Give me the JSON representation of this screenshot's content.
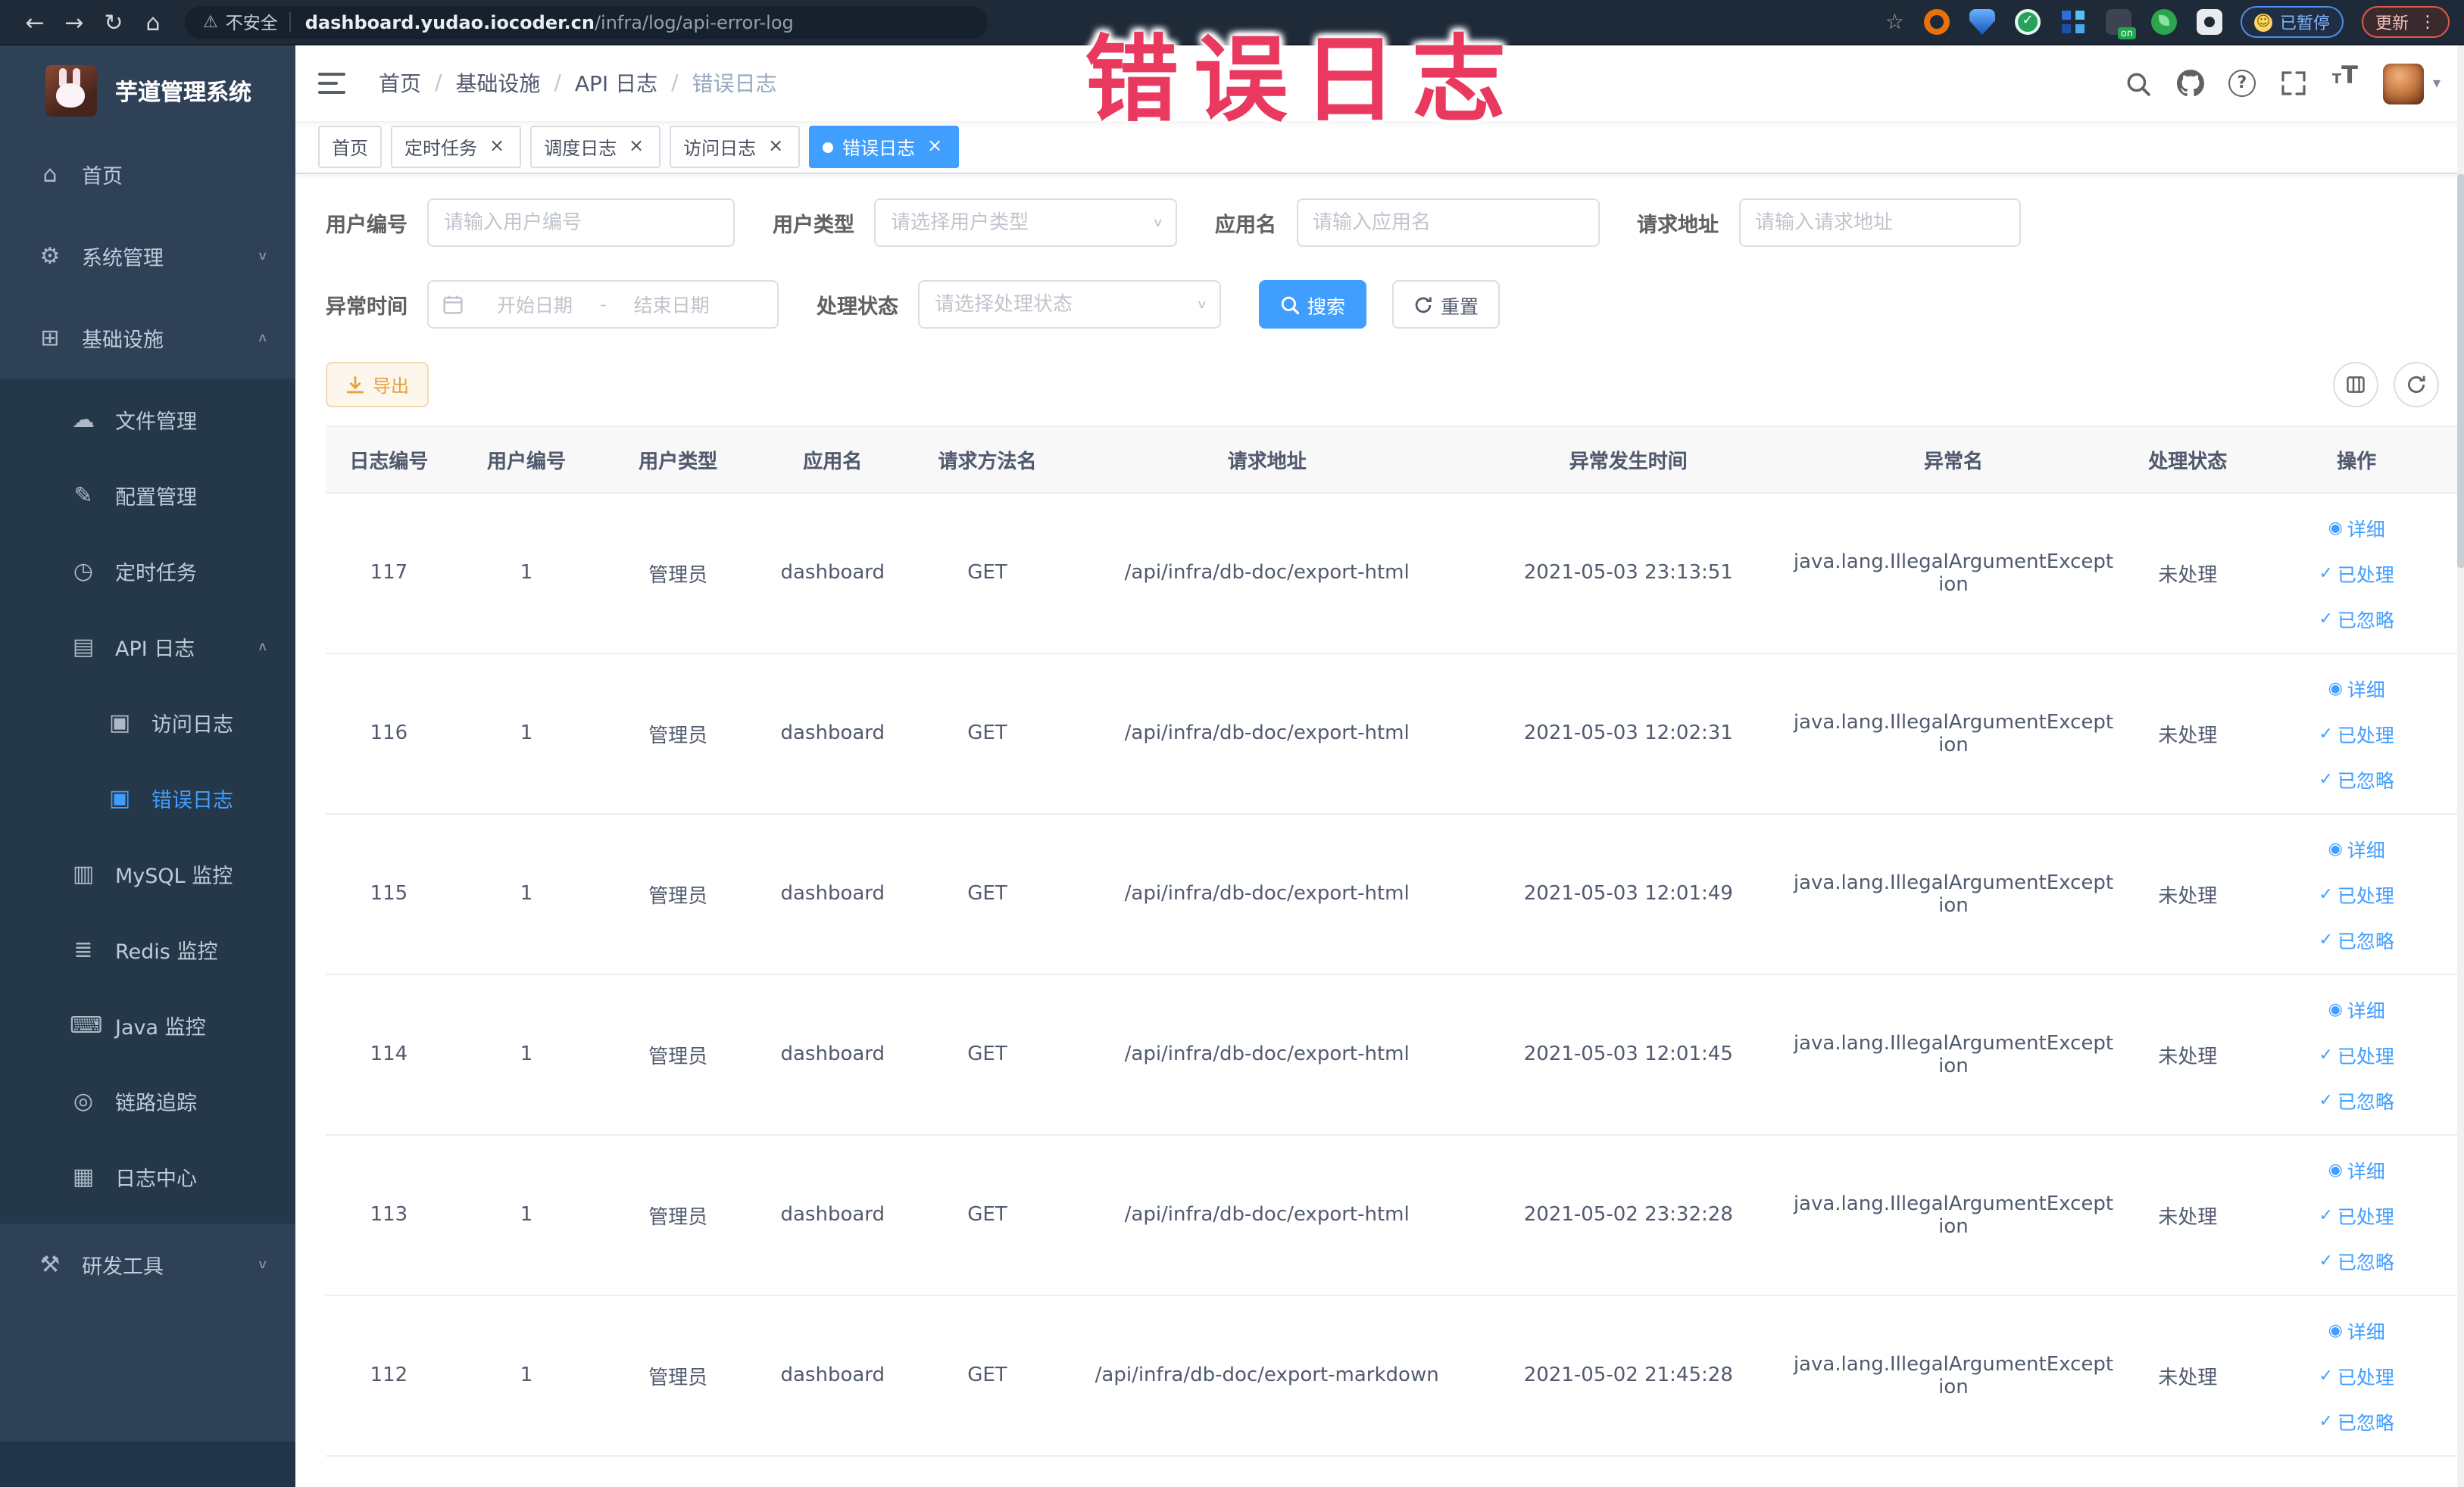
{
  "browser": {
    "security_label": "不安全",
    "url_domain": "dashboard.yudao.iocoder.cn",
    "url_path": "/infra/log/api-error-log",
    "ext_on_label": "on",
    "paused_badge_label": "已暂停",
    "update_button_label": "更新"
  },
  "annotation": {
    "text": "错误日志",
    "color": "#e9395e"
  },
  "sidebar": {
    "logo_title": "芋道管理系统",
    "items": [
      {
        "id": "home",
        "glyph": "⌂",
        "label": "首页",
        "level": 0
      },
      {
        "id": "system-mgmt",
        "glyph": "⚙",
        "label": "系统管理",
        "level": 0,
        "chevron": "down"
      },
      {
        "id": "infrastructure",
        "glyph": "⊞",
        "label": "基础设施",
        "level": 0,
        "chevron": "up"
      },
      {
        "id": "file-mgmt",
        "glyph": "☁",
        "label": "文件管理",
        "level": 1,
        "section": true
      },
      {
        "id": "config-mgmt",
        "glyph": "✎",
        "label": "配置管理",
        "level": 1,
        "section": true
      },
      {
        "id": "scheduled-task",
        "glyph": "◷",
        "label": "定时任务",
        "level": 1,
        "section": true
      },
      {
        "id": "api-log",
        "glyph": "▤",
        "label": "API 日志",
        "level": 1,
        "chevron": "up",
        "section": true
      },
      {
        "id": "access-log",
        "glyph": "▣",
        "label": "访问日志",
        "level": 2,
        "section": true
      },
      {
        "id": "error-log",
        "glyph": "▣",
        "label": "错误日志",
        "level": 2,
        "active": true,
        "section": true
      },
      {
        "id": "mysql-monitor",
        "glyph": "▥",
        "label": "MySQL 监控",
        "level": 1,
        "section": true
      },
      {
        "id": "redis-monitor",
        "glyph": "≣",
        "label": "Redis 监控",
        "level": 1,
        "section": true
      },
      {
        "id": "java-monitor",
        "glyph": "⌨",
        "label": "Java 监控",
        "level": 1,
        "section": true
      },
      {
        "id": "trace",
        "glyph": "◎",
        "label": "链路追踪",
        "level": 1,
        "section": true
      },
      {
        "id": "log-center",
        "glyph": "▦",
        "label": "日志中心",
        "level": 1,
        "section": true
      },
      {
        "id": "dev-tools",
        "glyph": "⚒",
        "label": "研发工具",
        "level": 0,
        "chevron": "down"
      }
    ]
  },
  "header": {
    "breadcrumb": [
      "首页",
      "基础设施",
      "API 日志",
      "错误日志"
    ],
    "separator": "/"
  },
  "tabs": [
    {
      "label": "首页",
      "closable": false,
      "active": false
    },
    {
      "label": "定时任务",
      "closable": true,
      "active": false
    },
    {
      "label": "调度日志",
      "closable": true,
      "active": false
    },
    {
      "label": "访问日志",
      "closable": true,
      "active": false
    },
    {
      "label": "错误日志",
      "closable": true,
      "active": true
    }
  ],
  "filters": {
    "user_id": {
      "label": "用户编号",
      "placeholder": "请输入用户编号"
    },
    "user_type": {
      "label": "用户类型",
      "placeholder": "请选择用户类型"
    },
    "app_name": {
      "label": "应用名",
      "placeholder": "请输入应用名"
    },
    "request_url": {
      "label": "请求地址",
      "placeholder": "请输入请求地址"
    },
    "exception_time": {
      "label": "异常时间",
      "start_placeholder": "开始日期",
      "separator": "-",
      "end_placeholder": "结束日期"
    },
    "process_status": {
      "label": "处理状态",
      "placeholder": "请选择处理状态"
    },
    "search_label": "搜索",
    "reset_label": "重置"
  },
  "toolbar": {
    "export_label": "导出"
  },
  "table": {
    "columns": [
      {
        "key": "log_id",
        "label": "日志编号",
        "width": "5.7%"
      },
      {
        "key": "user_id",
        "label": "用户编号",
        "width": "6.8%"
      },
      {
        "key": "user_type",
        "label": "用户类型",
        "width": "7.1%"
      },
      {
        "key": "app_name",
        "label": "应用名",
        "width": "7.1%"
      },
      {
        "key": "method",
        "label": "请求方法名",
        "width": "7.1%"
      },
      {
        "key": "url",
        "label": "请求地址",
        "width": "19.5%"
      },
      {
        "key": "time",
        "label": "异常发生时间",
        "width": "15.2%"
      },
      {
        "key": "exception",
        "label": "异常名",
        "width": "15.9%"
      },
      {
        "key": "status",
        "label": "处理状态",
        "width": "6.2%"
      },
      {
        "key": "actions",
        "label": "操作",
        "width": "9.4%"
      }
    ],
    "row_actions": [
      {
        "id": "detail",
        "label": "详细",
        "glyph": "◉",
        "icon": "eye-icon"
      },
      {
        "id": "processed",
        "label": "已处理",
        "glyph": "✓",
        "icon": "check-icon"
      },
      {
        "id": "ignored",
        "label": "已忽略",
        "glyph": "✓",
        "icon": "check-icon"
      }
    ],
    "rows": [
      {
        "log_id": "117",
        "user_id": "1",
        "user_type": "管理员",
        "app_name": "dashboard",
        "method": "GET",
        "url": "/api/infra/db-doc/export-html",
        "time": "2021-05-03 23:13:51",
        "exception": "java.lang.IllegalArgumentException",
        "status": "未处理"
      },
      {
        "log_id": "116",
        "user_id": "1",
        "user_type": "管理员",
        "app_name": "dashboard",
        "method": "GET",
        "url": "/api/infra/db-doc/export-html",
        "time": "2021-05-03 12:02:31",
        "exception": "java.lang.IllegalArgumentException",
        "status": "未处理"
      },
      {
        "log_id": "115",
        "user_id": "1",
        "user_type": "管理员",
        "app_name": "dashboard",
        "method": "GET",
        "url": "/api/infra/db-doc/export-html",
        "time": "2021-05-03 12:01:49",
        "exception": "java.lang.IllegalArgumentException",
        "status": "未处理"
      },
      {
        "log_id": "114",
        "user_id": "1",
        "user_type": "管理员",
        "app_name": "dashboard",
        "method": "GET",
        "url": "/api/infra/db-doc/export-html",
        "time": "2021-05-03 12:01:45",
        "exception": "java.lang.IllegalArgumentException",
        "status": "未处理"
      },
      {
        "log_id": "113",
        "user_id": "1",
        "user_type": "管理员",
        "app_name": "dashboard",
        "method": "GET",
        "url": "/api/infra/db-doc/export-html",
        "time": "2021-05-02 23:32:28",
        "exception": "java.lang.IllegalArgumentException",
        "status": "未处理"
      },
      {
        "log_id": "112",
        "user_id": "1",
        "user_type": "管理员",
        "app_name": "dashboard",
        "method": "GET",
        "url": "/api/infra/db-doc/export-markdown",
        "time": "2021-05-02 21:45:28",
        "exception": "java.lang.IllegalArgumentException",
        "status": "未处理"
      }
    ]
  },
  "colors": {
    "primary": "#409eff",
    "sidebar_bg": "#2e4156",
    "submenu_bg": "#253849",
    "warning": "#e6a23c",
    "annotation_red": "#e9395e"
  }
}
